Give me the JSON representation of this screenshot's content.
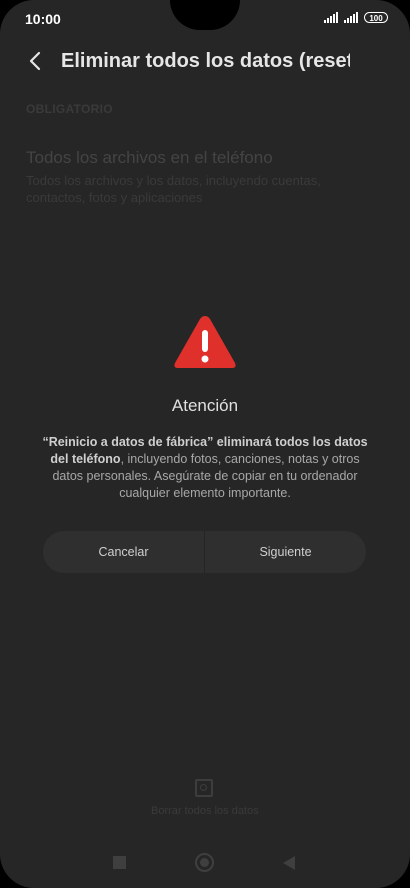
{
  "status_bar": {
    "time": "10:00",
    "battery": "100"
  },
  "header": {
    "title": "Eliminar todos los datos (resetear"
  },
  "section": {
    "label": "OBLIGATORIO"
  },
  "item": {
    "title": "Todos los archivos en el teléfono",
    "description": "Todos los archivos y los datos, incluyendo cuentas, contactos, fotos y aplicaciones"
  },
  "dialog": {
    "title": "Atención",
    "message_bold": "“Reinicio a datos de fábrica” eliminará todos los datos del teléfono",
    "message_rest": ", incluyendo fotos, canciones, notas y otros datos personales. Asegúrate de copiar en tu ordenador cualquier elemento importante.",
    "cancel_label": "Cancelar",
    "next_label": "Siguiente"
  },
  "bottom_action": {
    "label": "Borrar todos los datos"
  },
  "colors": {
    "background": "#262626",
    "warning": "#e0302c",
    "button": "#2f2f2f"
  },
  "icons": [
    "back-arrow-icon",
    "warning-icon",
    "erase-icon",
    "nav-recents-icon",
    "nav-home-icon",
    "nav-back-icon"
  ]
}
